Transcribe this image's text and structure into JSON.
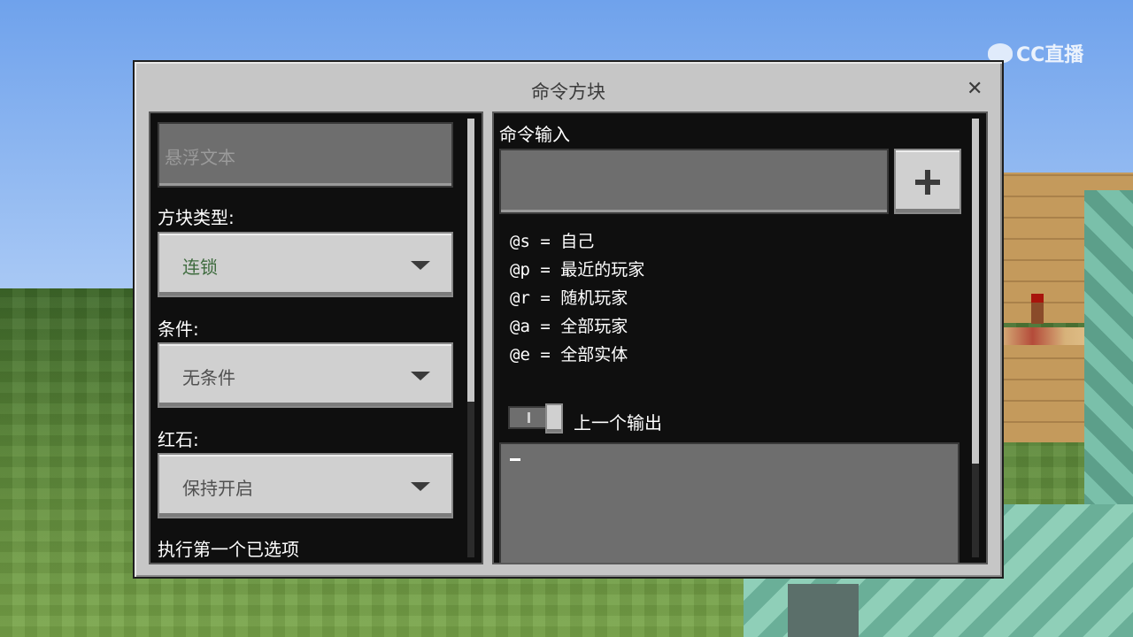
{
  "watermark": {
    "text": "CC直播"
  },
  "dialog": {
    "title": "命令方块",
    "close_glyph": "✕"
  },
  "left_panel": {
    "hover_text_placeholder": "悬浮文本",
    "block_type": {
      "label": "方块类型:",
      "value": "连锁"
    },
    "condition": {
      "label": "条件:",
      "value": "无条件"
    },
    "redstone": {
      "label": "红石:",
      "value": "保持开启"
    },
    "execute_label": "执行第一个已选项"
  },
  "right_panel": {
    "command_input_label": "命令输入",
    "command_value": "",
    "add_button_icon": "plus-icon",
    "selectors": [
      "@s = 自己",
      "@p = 最近的玩家",
      "@r = 随机玩家",
      "@a = 全部玩家",
      "@e = 全部实体"
    ],
    "previous_output_label": "上一个输出",
    "previous_output_toggle_on": false,
    "output_text": ""
  },
  "colors": {
    "dialog_bg": "#c6c6c6",
    "pane_bg": "#0f0f0f",
    "field_bg": "#6e6e6e",
    "button_bg": "#d0d0d0",
    "selected_value_green": "#3e6b3e"
  }
}
